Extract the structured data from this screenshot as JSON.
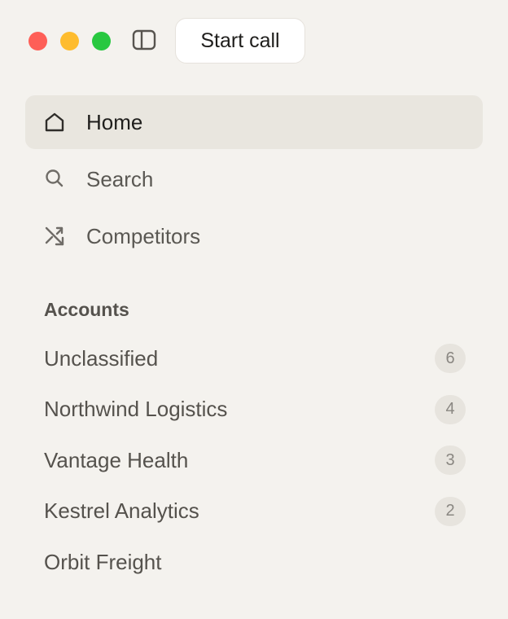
{
  "window": {
    "controls": [
      "close",
      "minimize",
      "maximize"
    ],
    "sidebar_toggle_icon": "sidebar-panel-icon",
    "start_call_label": "Start call"
  },
  "nav": {
    "items": [
      {
        "label": "Home",
        "icon": "home-icon",
        "active": true
      },
      {
        "label": "Search",
        "icon": "search-icon",
        "active": false
      },
      {
        "label": "Competitors",
        "icon": "arrows-cross-icon",
        "active": false
      }
    ]
  },
  "accounts": {
    "title": "Accounts",
    "items": [
      {
        "name": "Unclassified",
        "count": "6"
      },
      {
        "name": "Northwind Logistics",
        "count": "4"
      },
      {
        "name": "Vantage Health",
        "count": "3"
      },
      {
        "name": "Kestrel Analytics",
        "count": "2"
      },
      {
        "name": "Orbit Freight",
        "count": ""
      }
    ]
  },
  "colors": {
    "background": "#f4f2ee",
    "active_item": "#e9e6df",
    "close": "#fe5f57",
    "minimize": "#febc2e",
    "maximize": "#28c840"
  }
}
